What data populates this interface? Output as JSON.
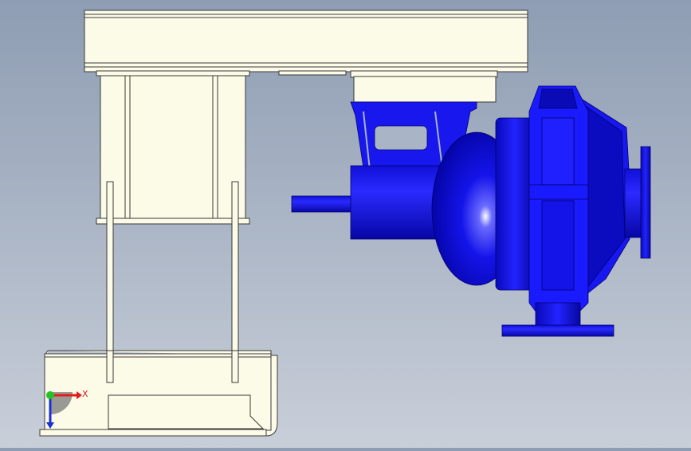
{
  "viewport": {
    "background_top": "#8e9db3",
    "background_bottom": "#c9cfd9"
  },
  "model": {
    "frame_color": "#fbfbe8",
    "frame_stroke": "#3a3a3a",
    "pump_color": "#1313e6",
    "pump_dark": "#0a0a9e",
    "pump_highlight": "#ffffff"
  },
  "triad": {
    "x_label": "X",
    "x_color": "#e01e1e",
    "y_color": "#22c322",
    "z_color": "#1a2fd6"
  }
}
